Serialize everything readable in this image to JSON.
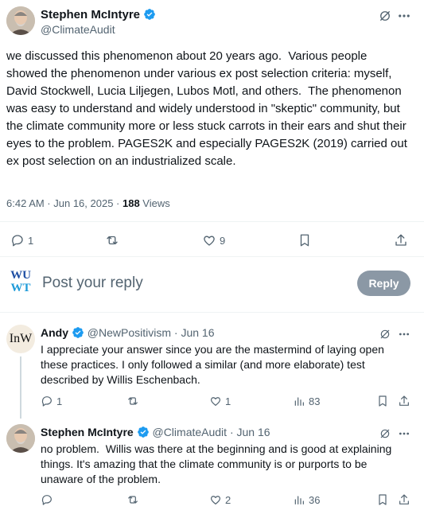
{
  "main_tweet": {
    "author_name": "Stephen McIntyre",
    "handle": "@ClimateAudit",
    "text": "we discussed this phenomenon about 20 years ago.  Various people showed the phenomenon under various ex post selection criteria: myself, David Stockwell, Lucia Liljegen, Lubos Motl, and others.  The phenomenon was easy to understand and widely understood in \"skeptic\" community, but the climate community more or less stuck carrots in their ears and shut their eyes to the problem. PAGES2K and especially PAGES2K (2019) carried out ex post selection on an industrialized scale.",
    "timestamp": "6:42 AM · Jun 16, 2025 · ",
    "views_count": "188",
    "views_label": " Views",
    "replies": "1",
    "retweets": "",
    "likes": "9"
  },
  "reply_box": {
    "avatar_text_top": "WU",
    "avatar_text_bottom": "WT",
    "placeholder": "Post your reply",
    "button": "Reply"
  },
  "replies": [
    {
      "avatar_text": "InW",
      "author_name": "Andy",
      "handle": "@NewPositivism",
      "date": " · Jun 16",
      "text": "I appreciate your answer since you are the mastermind of laying open these practices. I only followed a similar (and more elaborate) test described by Willis Eschenbach.",
      "replies": "1",
      "retweets": "",
      "likes": "1",
      "views": "83"
    },
    {
      "author_name": "Stephen McIntyre",
      "handle": "@ClimateAudit",
      "date": " · Jun 16",
      "text": "no problem.  Willis was there at the beginning and is good at explaining things. It's amazing that the climate community is or purports to be unaware of the problem.",
      "replies": "",
      "retweets": "",
      "likes": "2",
      "views": "36"
    }
  ],
  "colors": {
    "verified": "#1d9bf0",
    "text": "#0f1419",
    "muted": "#536471",
    "reply_button_bg": "#8b98a5",
    "logo_blue": "#1f4fa3"
  }
}
